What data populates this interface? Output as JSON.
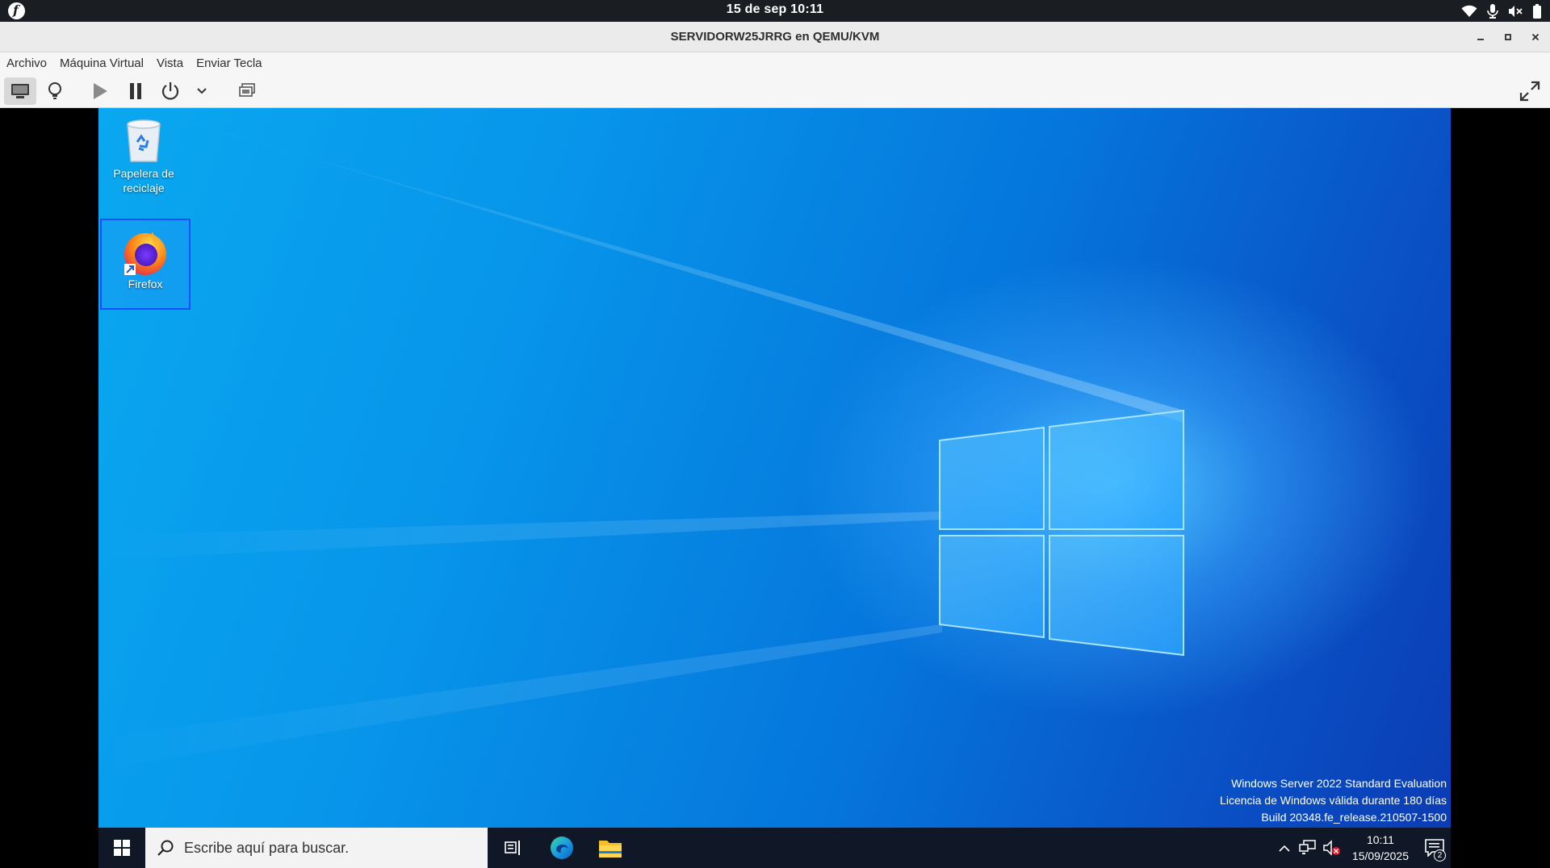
{
  "topbar": {
    "clock": "15 de sep  10:11",
    "icons": [
      "fedora-logo",
      "wifi-icon",
      "microphone-icon",
      "speaker-muted-icon",
      "battery-icon"
    ]
  },
  "window": {
    "title": "SERVIDORW25JRRG en QEMU/KVM",
    "controls": [
      "minimize-icon",
      "maximize-icon",
      "close-icon"
    ]
  },
  "menubar": {
    "items": [
      "Archivo",
      "Máquina Virtual",
      "Vista",
      "Enviar Tecla"
    ]
  },
  "toolbar": {
    "buttons": [
      "console-icon",
      "details-bulb-icon",
      "play-icon",
      "pause-icon",
      "power-icon",
      "chevron-down-icon",
      "snapshots-icon",
      "fullscreen-icon"
    ]
  },
  "desktop": {
    "icons": [
      {
        "label_line1": "Papelera de",
        "label_line2": "reciclaje",
        "icon": "recycle-bin-icon"
      },
      {
        "label": "Firefox",
        "icon": "firefox-icon",
        "selected": true
      }
    ],
    "watermark": {
      "line1": "Windows Server 2022 Standard Evaluation",
      "line2": "Licencia de Windows válida durante 180 días",
      "line3": "Build 20348.fe_release.210507-1500"
    }
  },
  "taskbar": {
    "search_placeholder": "Escribe aquí para buscar.",
    "time": "10:11",
    "date": "15/09/2025",
    "notifications_count": "2",
    "apps": [
      "task-view-icon",
      "edge-icon",
      "file-explorer-icon"
    ],
    "tray": [
      "chevron-up-icon",
      "network-icon",
      "volume-muted-icon",
      "notification-icon"
    ]
  }
}
